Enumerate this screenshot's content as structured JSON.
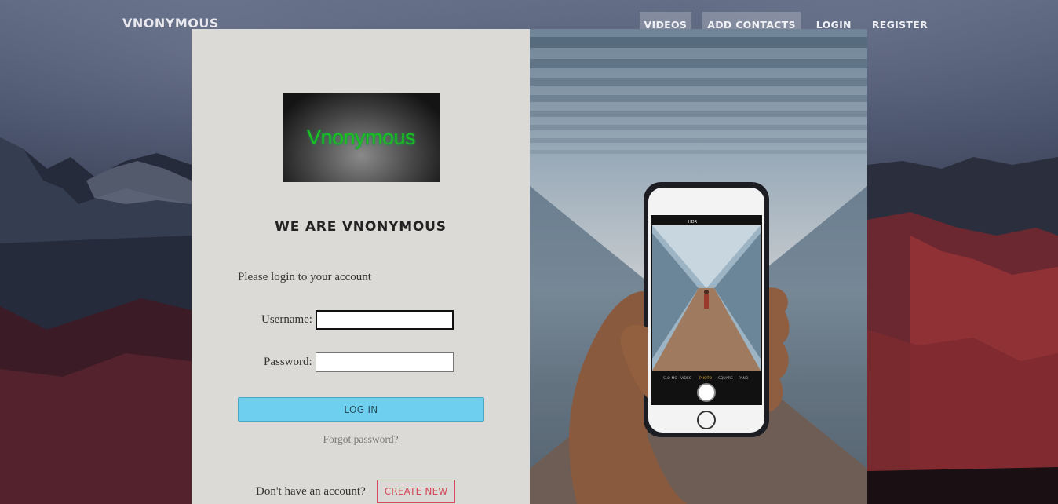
{
  "brand": "VNONYMOUS",
  "nav": {
    "videos": "VIDEOS",
    "add_contacts": "ADD CONTACTS",
    "login": "LOGIN",
    "register": "REGISTER"
  },
  "card": {
    "logo_text": "Vnonymous",
    "headline": "WE ARE VNONYMOUS",
    "prompt": "Please login to your account",
    "username_label": "Username:",
    "username_value": "",
    "password_label": "Password:",
    "password_value": "",
    "login_button": "LOG IN",
    "forgot_link": "Forgot password?",
    "signup_text": "Don't have an account?",
    "create_button": "CREATE NEW"
  },
  "colors": {
    "login_button": "#6ecfee",
    "create_button": "#d44a5a",
    "logo_text": "#1fc11f",
    "card_panel": "#dcdad7"
  },
  "phone_ui": {
    "top_label": "HDR",
    "modes": [
      "SLO-MO",
      "VIDEO",
      "PHOTO",
      "SQUARE",
      "PANO"
    ]
  }
}
